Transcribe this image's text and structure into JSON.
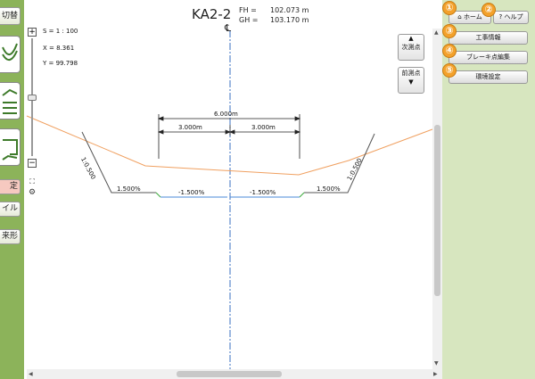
{
  "header": {
    "title": "KA2-2",
    "fh_label": "FH =",
    "fh_value": "102.073 m",
    "gh_label": "GH =",
    "gh_value": "103.170 m",
    "centerline": "℄"
  },
  "info": {
    "scale": "S = 1 : 100",
    "x": "X = 8.361",
    "y": "Y = 99.798"
  },
  "nav": {
    "next_label": "次測点",
    "prev_label": "前測点"
  },
  "left_menu": {
    "item_cut": "切替",
    "item_selected": "定",
    "item_file": "イル",
    "item_shape": "来形"
  },
  "right_menu": {
    "home": "ホーム",
    "help": "ヘルプ",
    "construction_info": "工事情報",
    "break_point_edit": "ブレーキ点編集",
    "environment_settings": "環境設定"
  },
  "badges": [
    "①",
    "②",
    "③",
    "④",
    "⑤"
  ],
  "dimensions": {
    "total": "6.000m",
    "left_half": "3.000m",
    "right_half": "3.000m"
  },
  "slopes": {
    "left_side": "1:0.500",
    "right_side": "1:0.500",
    "left_bottom": "1.500%",
    "left_center": "-1.500%",
    "right_center": "-1.500%",
    "right_bottom": "1.500%"
  },
  "colors": {
    "left_sidebar": "#8cb35a",
    "right_sidebar": "#d7e6bf",
    "ground_line": "#f0a060",
    "design_line": "#666666",
    "centerline": "#3a6fc0",
    "badge": "#f3a12b"
  }
}
